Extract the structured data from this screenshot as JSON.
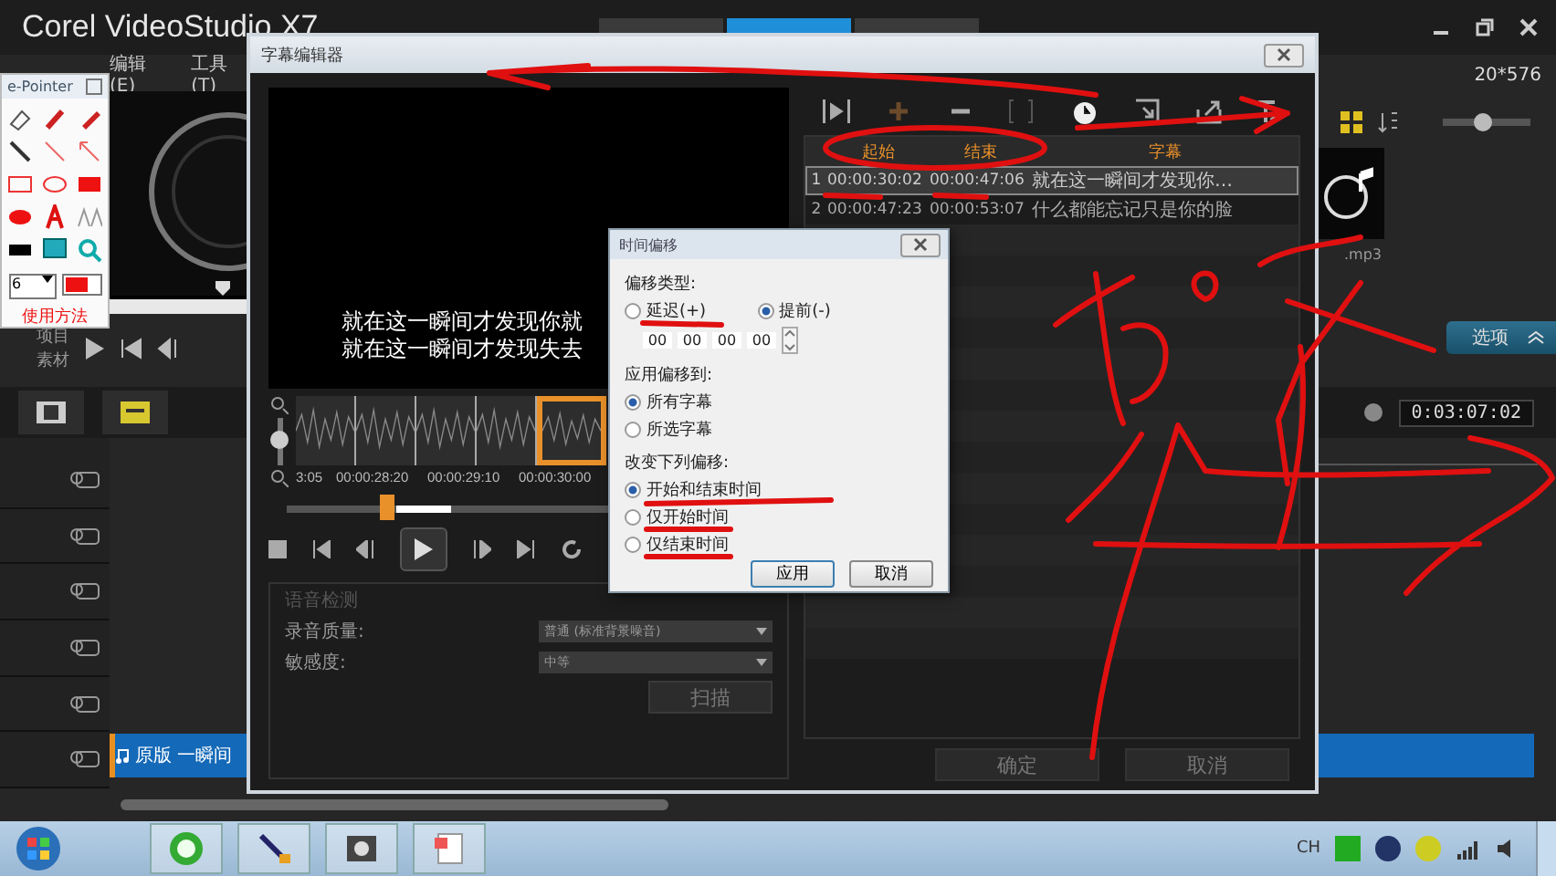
{
  "app": {
    "title": "Corel VideoStudio X7",
    "tabs": [
      {
        "selected": false
      },
      {
        "selected": true
      },
      {
        "selected": false
      }
    ],
    "menu": [
      "编辑(E)",
      "工具(T)"
    ],
    "preview_modes": [
      "项目",
      "素材"
    ]
  },
  "library": {
    "resolution": "20*576",
    "thumbnail_size": {
      "level": 0.45
    },
    "thumbnail_label": ".mp3",
    "options_button": "选项"
  },
  "timeline": {
    "timecode": "0:03:07:02",
    "clip": "原版 一瞬间"
  },
  "epointer": {
    "title": "e-Pointer",
    "size": "6",
    "help": "使用方法"
  },
  "subtitle_editor": {
    "title": "字幕编辑器",
    "preview_lines": [
      "就在这一瞬间才发现你就",
      "就在这一瞬间才发现失去"
    ],
    "ruler": [
      "3:05",
      "00:00:28:20",
      "00:00:29:10",
      "00:00:30:00"
    ],
    "scrub": {
      "level": 0.2
    },
    "zoom": {
      "level": 0.55
    },
    "columns": [
      "起始",
      "结束",
      "字幕"
    ],
    "rows": [
      {
        "index": "1",
        "start": "00:00:30:02",
        "end": "00:00:47:06",
        "text": "就在这一瞬间才发现你…",
        "selected": true
      },
      {
        "index": "2",
        "start": "00:00:47:23",
        "end": "00:00:53:07",
        "text": "什么都能忘记只是你的脸",
        "selected": false
      }
    ],
    "speech": {
      "title": "语音检测",
      "fields": [
        {
          "label": "录音质量:",
          "value": "普通 (标准背景噪音)"
        },
        {
          "label": "敏感度:",
          "value": "中等"
        }
      ],
      "scan_button": "扫描"
    },
    "buttons": [
      "确定",
      "取消"
    ]
  },
  "offset_dialog": {
    "title": "时间偏移",
    "groups": [
      {
        "label": "偏移类型:",
        "kind": "row",
        "options": [
          {
            "label": "延迟(+)",
            "selected": false
          },
          {
            "label": "提前(-)",
            "selected": true
          }
        ]
      },
      {
        "label": "应用偏移到:",
        "kind": "column",
        "options": [
          {
            "label": "所有字幕",
            "selected": true
          },
          {
            "label": "所选字幕",
            "selected": false
          }
        ]
      },
      {
        "label": "改变下列偏移:",
        "kind": "column",
        "options": [
          {
            "label": "开始和结束时间",
            "selected": true
          },
          {
            "label": "仅开始时间",
            "selected": false
          },
          {
            "label": "仅结束时间",
            "selected": false
          }
        ]
      }
    ],
    "time_fields": [
      "00",
      "00",
      "00",
      "00"
    ],
    "buttons": [
      "应用",
      "取消"
    ]
  },
  "taskbar": {
    "language": "CH"
  }
}
